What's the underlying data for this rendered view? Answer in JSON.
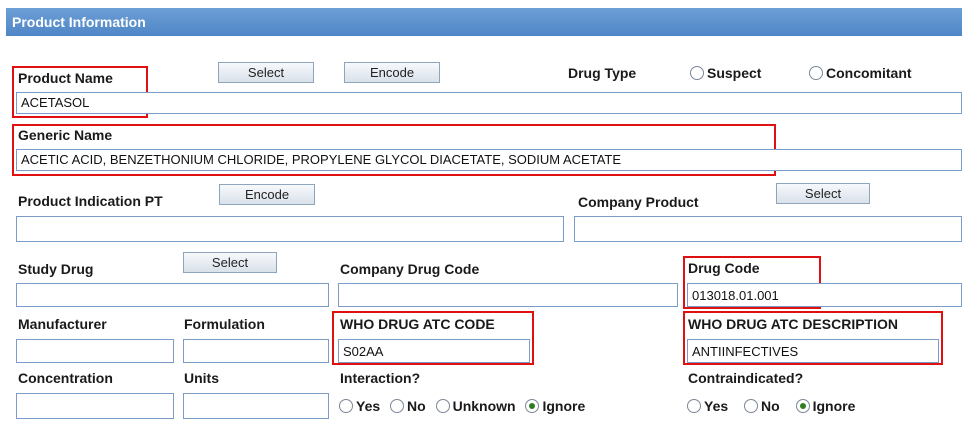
{
  "section_title": "Product Information",
  "product_name": {
    "label": "Product Name",
    "value": "ACETASOL",
    "select_label": "Select",
    "encode_label": "Encode"
  },
  "drug_type": {
    "label": "Drug Type",
    "options": [
      "Suspect",
      "Concomitant"
    ]
  },
  "generic_name": {
    "label": "Generic Name",
    "value": "ACETIC ACID, BENZETHONIUM CHLORIDE, PROPYLENE GLYCOL DIACETATE, SODIUM ACETATE"
  },
  "product_indication": {
    "label": "Product Indication PT",
    "encode_label": "Encode",
    "value": ""
  },
  "company_product": {
    "label": "Company Product",
    "select_label": "Select",
    "value": ""
  },
  "study_drug": {
    "label": "Study Drug",
    "select_label": "Select",
    "value": ""
  },
  "company_drug_code": {
    "label": "Company Drug Code",
    "value": ""
  },
  "drug_code": {
    "label": "Drug Code",
    "value": "013018.01.001"
  },
  "manufacturer": {
    "label": "Manufacturer",
    "value": ""
  },
  "formulation": {
    "label": "Formulation",
    "value": ""
  },
  "who_atc_code": {
    "label": "WHO DRUG ATC CODE",
    "value": "S02AA"
  },
  "who_atc_description": {
    "label": "WHO DRUG ATC DESCRIPTION",
    "value": "ANTIINFECTIVES"
  },
  "concentration": {
    "label": "Concentration",
    "value": ""
  },
  "units": {
    "label": "Units",
    "value": ""
  },
  "interaction": {
    "label": "Interaction?",
    "options": [
      "Yes",
      "No",
      "Unknown",
      "Ignore"
    ],
    "selected": "Ignore"
  },
  "contraindicated": {
    "label": "Contraindicated?",
    "options": [
      "Yes",
      "No",
      "Ignore"
    ],
    "selected": "Ignore"
  }
}
